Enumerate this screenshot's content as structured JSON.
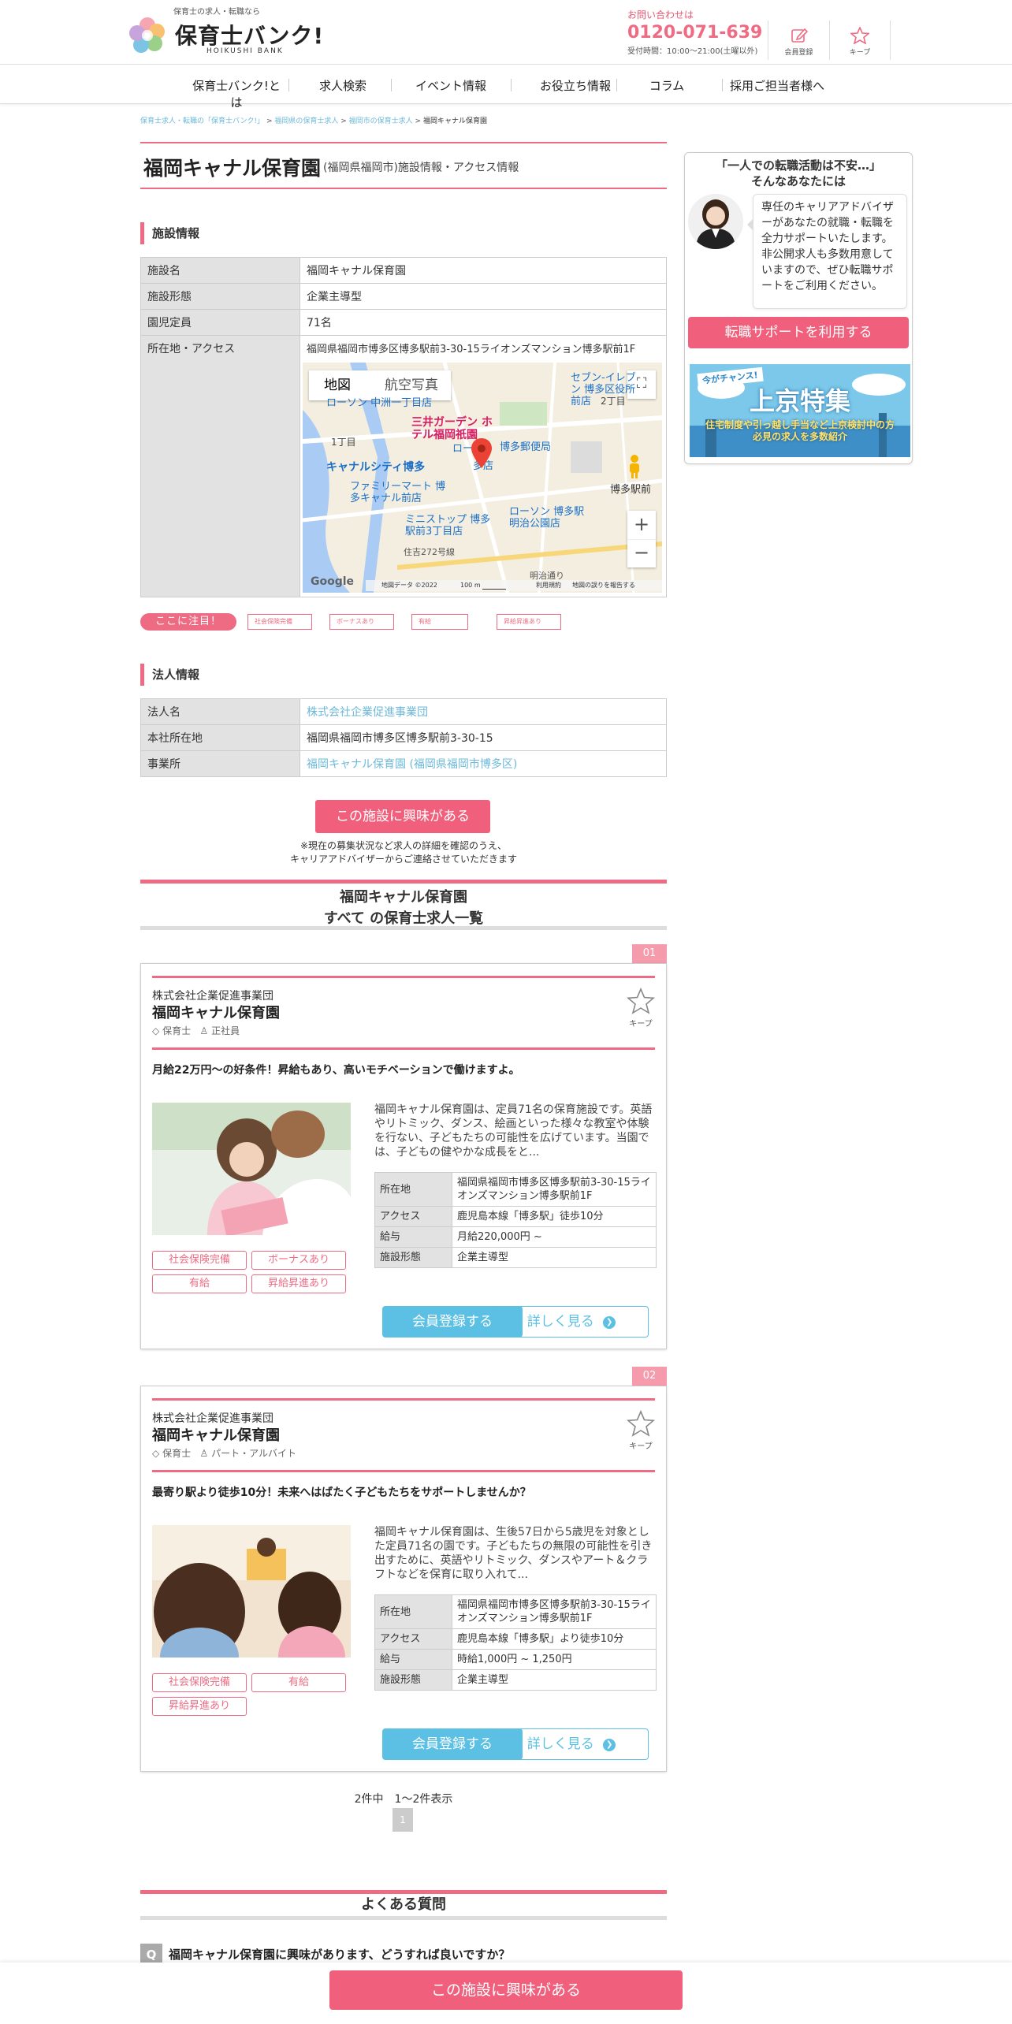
{
  "header": {
    "tagline": "保育士の求人・転職なら",
    "logo_text": "保育士バンク!",
    "logo_sub": "HOIKUSHI BANK",
    "contact_label": "お問い合わせは",
    "tel": "0120-071-639",
    "hours": "受付時間：10:00〜21:00(土曜以外)",
    "member_label": "会員登録",
    "keep_label": "キープ"
  },
  "nav": [
    "保育士バンク!とは",
    "求人検索",
    "イベント情報",
    "お役立ち情報",
    "コラム",
    "採用ご担当者様へ"
  ],
  "breadcrumb": [
    "保育士求人・転職の「保育士バンク!」",
    "福岡県の保育士求人",
    "福岡市の保育士求人",
    "福岡キャナル保育園"
  ],
  "page": {
    "title": "福岡キャナル保育園",
    "subtitle": "(福岡県福岡市)施設情報・アクセス情報"
  },
  "facility": {
    "heading": "施設情報",
    "rows": [
      {
        "k": "施設名",
        "v": "福岡キャナル保育園"
      },
      {
        "k": "施設形態",
        "v": "企業主導型"
      },
      {
        "k": "園児定員",
        "v": "71名"
      },
      {
        "k": "所在地・アクセス",
        "v": "福岡県福岡市博多区博多駅前3-30-15ライオンズマンション博多駅前1F"
      }
    ]
  },
  "map": {
    "tab_map": "地図",
    "tab_photo": "航空写真",
    "labels": [
      "セブン-イレブン 博多区役所前店",
      "ローソン 中洲一丁目店",
      "三井ガーデン ホテル福岡祇園",
      "博多駅前",
      "キャナルシティ博多",
      "ファミリーマート 博多キャナル前店",
      "ミニストップ 博多 駅前3丁目店",
      "ローソン 博多駅 明治公園店",
      "博多郵便局",
      "2丁目",
      "1丁目",
      "住吉272号線",
      "明治通り",
      "ロー",
      "多店"
    ],
    "footer": [
      "地図データ ©2022",
      "100 m",
      "利用規約",
      "地図の誤りを報告する"
    ],
    "google": "Google"
  },
  "highlight": {
    "label": "ここに注目！",
    "tags": [
      "社会保険完備",
      "ボーナスあり",
      "有給",
      "昇給昇進あり"
    ]
  },
  "corp": {
    "heading": "法人情報",
    "rows": [
      {
        "k": "法人名",
        "v": "株式会社企業促進事業団"
      },
      {
        "k": "本社所在地",
        "v": "福岡県福岡市博多区博多駅前3-30-15"
      },
      {
        "k": "事業所",
        "v": "福岡キャナル保育園 (福岡県福岡市博多区)"
      }
    ]
  },
  "interest": {
    "button": "この施設に興味がある",
    "note1": "※現在の募集状況など求人の詳細を確認のうえ、",
    "note2": "キャリアアドバイザーからご連絡させていただきます"
  },
  "list": {
    "title1": "福岡キャナル保育園",
    "title2": "すべて の保育士求人一覧"
  },
  "jobs": [
    {
      "num": "01",
      "corp": "株式会社企業促進事業団",
      "name": "福岡キャナル保育園",
      "role": "保育士",
      "type": "正社員",
      "keep": "キープ",
      "catch": "月給22万円～の好条件！昇給もあり、高いモチベーションで働けますよ。",
      "desc": "福岡キャナル保育園は、定員71名の保育施設です。英語やリトミック、ダンス、絵画といった様々な教室や体験を行ない、子どもたちの可能性を広げています。当園では、子どもの健やかな成長をと...",
      "rows": [
        {
          "k": "所在地",
          "v": "福岡県福岡市博多区博多駅前3-30-15ライオンズマンション博多駅前1F"
        },
        {
          "k": "アクセス",
          "v": "鹿児島本線「博多駅」徒歩10分"
        },
        {
          "k": "給与",
          "v": "月給220,000円 ~"
        },
        {
          "k": "施設形態",
          "v": "企業主導型"
        }
      ],
      "tags": [
        "社会保険完備",
        "ボーナスあり",
        "有給",
        "昇給昇進あり"
      ],
      "btn_reg": "会員登録する",
      "btn_more": "詳しく見る"
    },
    {
      "num": "02",
      "corp": "株式会社企業促進事業団",
      "name": "福岡キャナル保育園",
      "role": "保育士",
      "type": "パート・アルバイト",
      "keep": "キープ",
      "catch": "最寄り駅より徒歩10分！未来へはばたく子どもたちをサポートしませんか？",
      "desc": "福岡キャナル保育園は、生後57日から5歳児を対象とした定員71名の園です。子どもたちの無限の可能性を引き出すために、英語やリトミック、ダンスやアート＆クラフトなどを保育に取り入れて...",
      "rows": [
        {
          "k": "所在地",
          "v": "福岡県福岡市博多区博多駅前3-30-15ライオンズマンション博多駅前1F"
        },
        {
          "k": "アクセス",
          "v": "鹿児島本線「博多駅」より徒歩10分"
        },
        {
          "k": "給与",
          "v": "時給1,000円 ~ 1,250円"
        },
        {
          "k": "施設形態",
          "v": "企業主導型"
        }
      ],
      "tags": [
        "社会保険完備",
        "有給",
        "昇給昇進あり"
      ],
      "btn_reg": "会員登録する",
      "btn_more": "詳しく見る"
    }
  ],
  "pager": {
    "text": "2件中　1〜2件表示",
    "current": "1"
  },
  "faq": {
    "heading": "よくある質問",
    "q_badge": "Q",
    "q1": "福岡キャナル保育園に興味があります、どうすれば良いですか？"
  },
  "sticky_button": "この施設に興味がある",
  "sidebar": {
    "q1": "「一人での転職活動は不安…」",
    "q2": "そんなあなたには",
    "bubble": "専任のキャリアアドバイザーがあなたの就職・転職を全力サポートいたします。非公開求人も多数用意していますので、ぜひ転職サポートをご利用ください。",
    "button": "転職サポートを利用する",
    "banner_chance": "今がチャンス!",
    "banner_title": "上京特集",
    "banner_sub": "住宅制度や引っ越し手当など上京検討中の方必見の求人を多数紹介"
  },
  "colors": {
    "accent": "#ef6b83",
    "link": "#6cb9d9",
    "cta_blue": "#5bc0e3"
  }
}
